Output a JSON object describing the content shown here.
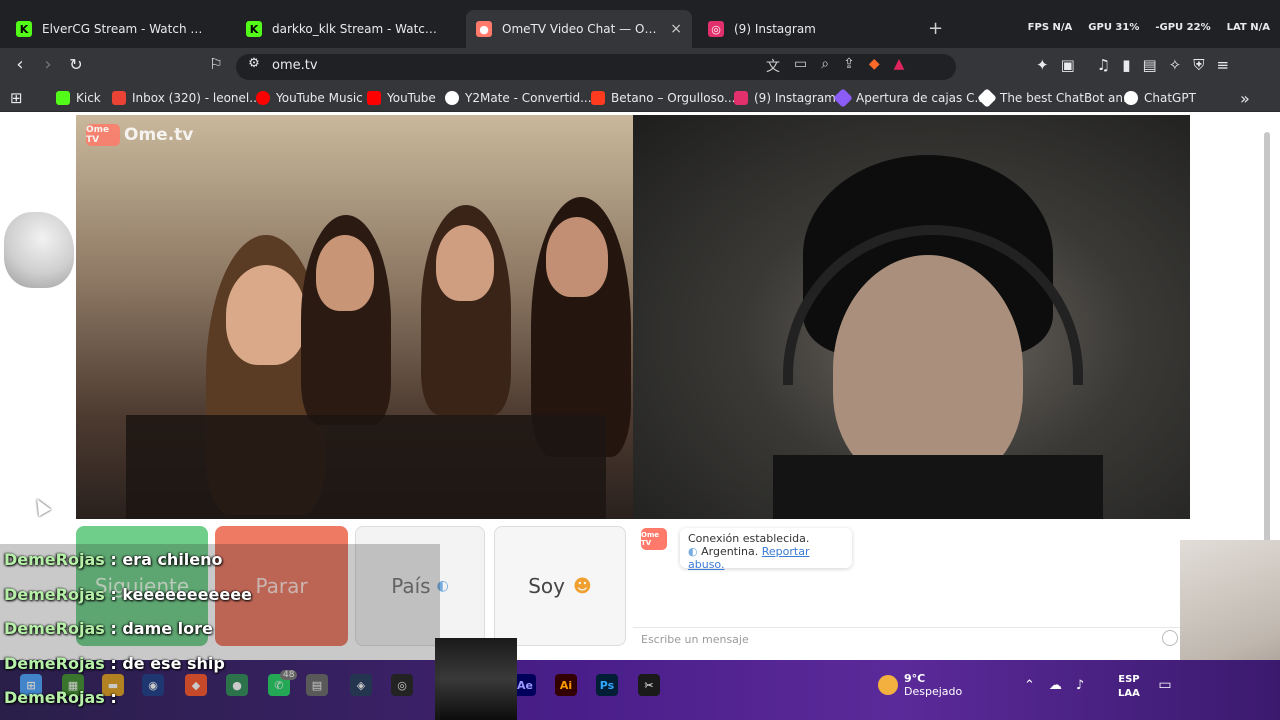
{
  "tabs": [
    {
      "label": "ElverCG Stream - Watch Live on K",
      "icon": "kick-icon",
      "color": "#53fc18"
    },
    {
      "label": "darkko_klk Stream - Watch Live on Ki",
      "icon": "kick-icon",
      "color": "#53fc18"
    },
    {
      "label": "OmeTV Video Chat — Omegl",
      "icon": "ometv-icon",
      "color": "#ff7a6a",
      "active": true,
      "close": "×"
    },
    {
      "label": "(9) Instagram",
      "icon": "instagram-icon",
      "color": "#e1306c"
    }
  ],
  "new_tab": "+",
  "stats": {
    "fps": "FPS N/A",
    "gpu": "GPU 31%",
    "gpu2": "-GPU 22%",
    "lat": "LAT N/A"
  },
  "toolbar": {
    "url": "ome.tv"
  },
  "bookmarks": [
    {
      "label": "Kick",
      "color": "#53fc18"
    },
    {
      "label": "Inbox (320) - leonel...",
      "color": "#ea4335"
    },
    {
      "label": "YouTube Music",
      "color": "#ff0000"
    },
    {
      "label": "YouTube",
      "color": "#ff0000"
    },
    {
      "label": "Y2Mate - Convertid...",
      "color": "#ffffff"
    },
    {
      "label": "Betano – Orgulloso...",
      "color": "#ff3b1f"
    },
    {
      "label": "(9) Instagram",
      "color": "#e1306c"
    },
    {
      "label": "Apertura de cajas C...",
      "color": "#8b5cf6"
    },
    {
      "label": "The best ChatBot an...",
      "color": "#ffffff"
    },
    {
      "label": "ChatGPT",
      "color": "#ffffff"
    }
  ],
  "page": {
    "logo": "Ome.tv",
    "logo_box": "Ome TV",
    "buttons": {
      "next": "Siguiente",
      "stop": "Parar",
      "country": "País",
      "soy": "Soy"
    },
    "chat": {
      "status": "Conexión establecida.",
      "country": "Argentina.",
      "report": "Reportar abuso.",
      "placeholder": "Escribe un mensaje"
    }
  },
  "stream_chat": [
    {
      "user": "DemeRojas",
      "msg": ": era chileno"
    },
    {
      "user": "DemeRojas",
      "msg": ": keeeeeeeeeee"
    },
    {
      "user": "DemeRojas",
      "msg": ": dame lore"
    },
    {
      "user": "DemeRojas",
      "msg": ": de ese ship"
    },
    {
      "user": "DemeRojas",
      "msg": ":"
    }
  ],
  "taskbar": {
    "weather_temp": "9°C",
    "weather_desc": "Despejado",
    "lang_top": "ESP",
    "lang_bottom": "LAA",
    "whatsapp_badge": "48"
  }
}
